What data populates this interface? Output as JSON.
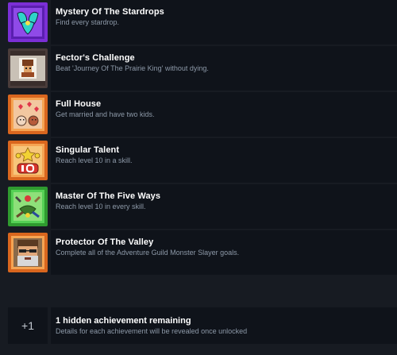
{
  "achievements": [
    {
      "title": "Mystery Of The Stardrops",
      "description": "Find every stardrop.",
      "icon": "stardrop-icon",
      "frame_color": "#8a2be2"
    },
    {
      "title": "Fector's Challenge",
      "description": "Beat 'Journey Of The Prairie King' without dying.",
      "icon": "prairie-king-icon",
      "frame_color": "#6b5a55"
    },
    {
      "title": "Full House",
      "description": "Get married and have two kids.",
      "icon": "family-hearts-icon",
      "frame_color": "#e07a2a"
    },
    {
      "title": "Singular Talent",
      "description": "Reach level 10 in a skill.",
      "icon": "level-ten-icon",
      "frame_color": "#e07a2a"
    },
    {
      "title": "Master Of The Five Ways",
      "description": "Reach level 10 in every skill.",
      "icon": "five-ways-icon",
      "frame_color": "#3fbf3f"
    },
    {
      "title": "Protector Of The Valley",
      "description": "Complete all of the Adventure Guild Monster Slayer goals.",
      "icon": "gil-portrait-icon",
      "frame_color": "#e07a2a"
    }
  ],
  "hidden": {
    "count_label": "+1",
    "title": "1 hidden achievement remaining",
    "description": "Details for each achievement will be revealed once unlocked"
  }
}
